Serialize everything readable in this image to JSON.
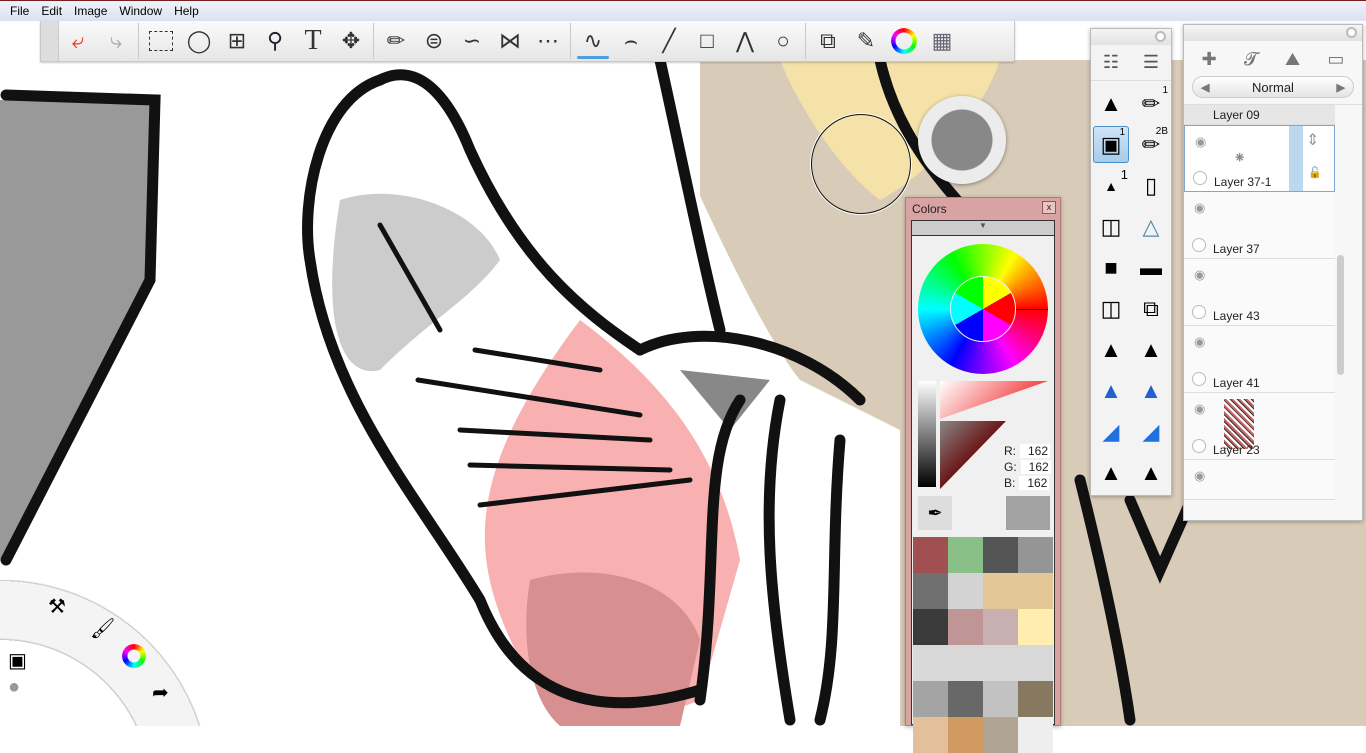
{
  "menu": [
    "File",
    "Edit",
    "Image",
    "Window",
    "Help"
  ],
  "toolbar": {
    "icons": [
      "undo-icon",
      "redo-icon",
      "rect-select-icon",
      "lasso-icon",
      "crop-icon",
      "zoom-icon",
      "text-icon",
      "move-icon",
      "ruler-icon",
      "ellipse-guide-icon",
      "french-curve-icon",
      "symmetry-x-icon",
      "symmetry-y-icon",
      "stroke-icon",
      "curve-icon",
      "line-icon",
      "rectangle-icon",
      "polyline-icon",
      "ellipse-icon",
      "copy-paste-icon",
      "brushes-icon",
      "color-wheel-icon",
      "palette-icon"
    ],
    "text_tool_glyph": "T"
  },
  "brushes": {
    "labels": [
      "1",
      "1",
      "2B",
      "1"
    ]
  },
  "layers": {
    "blend_mode": "Normal",
    "items": [
      {
        "name": "Layer 09"
      },
      {
        "name": "Layer 37-1",
        "selected": true
      },
      {
        "name": "Layer 37"
      },
      {
        "name": "Layer 43"
      },
      {
        "name": "Layer 41"
      },
      {
        "name": "Layer 23"
      }
    ]
  },
  "colors": {
    "title": "Colors",
    "close": "x",
    "r_label": "R:",
    "g_label": "G:",
    "b_label": "B:",
    "r": "162",
    "g": "162",
    "b": "162",
    "current": "#a2a2a2",
    "swatches": [
      "#a05050",
      "#88c088",
      "#555555",
      "#959595",
      "#707070",
      "#d3d3d3",
      "#e3c795",
      "#e3c795",
      "#3b3b3b",
      "#c09595",
      "#c8b0b0",
      "#ffeeb0",
      "#d8d8d8",
      "#d8d8d8",
      "#d8d8d8",
      "#d8d8d8",
      "#a4a4a4",
      "#686868",
      "#c2c2c2",
      "#877860",
      "#e4c09a",
      "#d09a60",
      "#b0a595",
      "#eeeeee"
    ]
  }
}
